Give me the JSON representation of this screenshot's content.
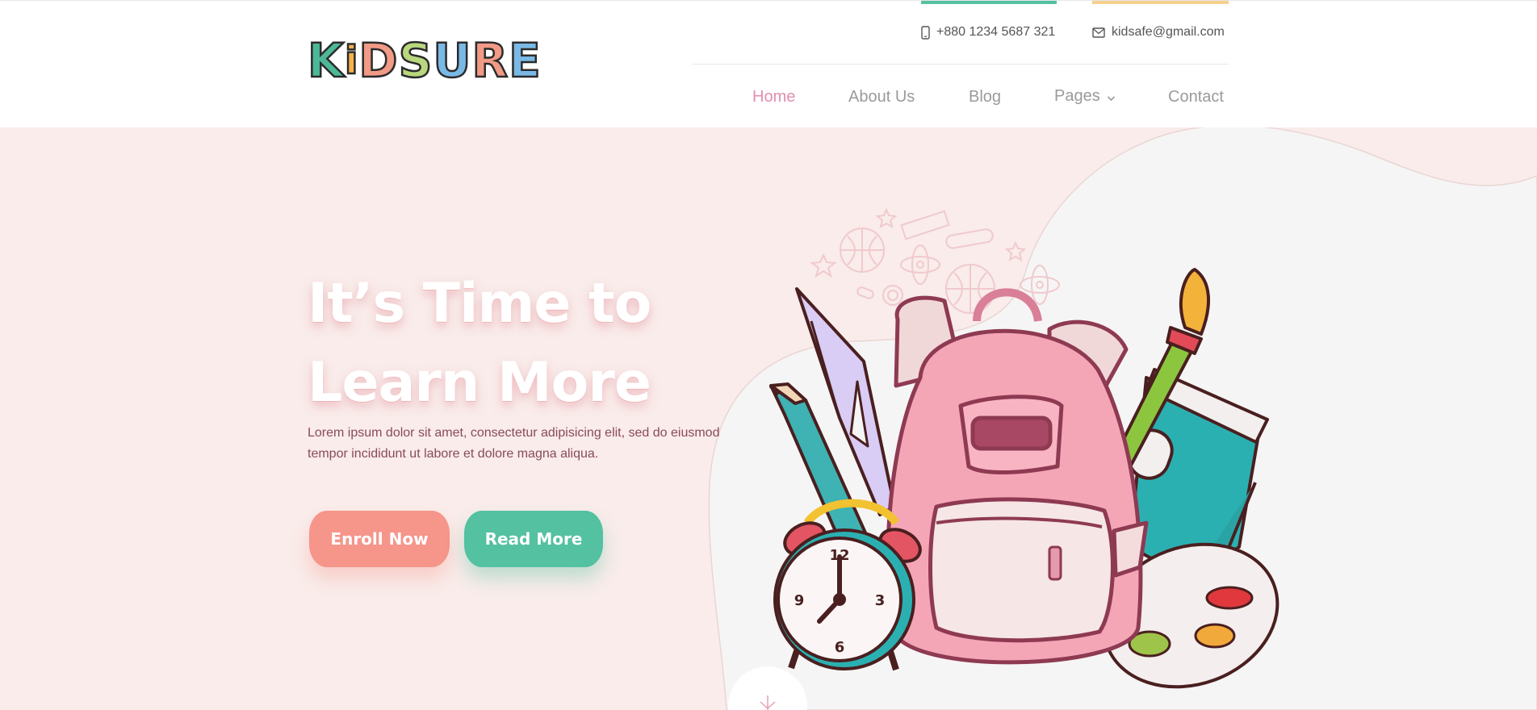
{
  "brand": {
    "logo_letters": [
      "K",
      "i",
      "D",
      "S",
      "U",
      "R",
      "E"
    ],
    "logo_colors": [
      "#4db897",
      "#f4b34a",
      "#f19a86",
      "#b9d77e",
      "#7ab9e6",
      "#f19a86",
      "#7ab9e6"
    ]
  },
  "topbar": {
    "phone": "+880 1234 5687 321",
    "email": "kidsafe@gmail.com",
    "phone_accent": "#54c1a1",
    "email_accent": "#f7cf8f"
  },
  "nav": {
    "home": "Home",
    "about": "About Us",
    "blog": "Blog",
    "pages": "Pages",
    "contact": "Contact",
    "active_color": "#e28fb0"
  },
  "hero": {
    "title_line1": "It’s Time to",
    "title_line2": "Learn More",
    "description": "Lorem ipsum dolor sit amet, consectetur adipisicing elit, sed do eiusmod tempor incididunt ut labore et dolore magna aliqua.",
    "enroll_label": "Enroll Now",
    "read_label": "Read More",
    "background": "#f9ecea"
  },
  "illustration": {
    "subject": "school backpack with books, pencil, ruler, paint brush, palette and alarm clock",
    "clock_numbers": [
      "12",
      "3",
      "6",
      "9"
    ]
  }
}
